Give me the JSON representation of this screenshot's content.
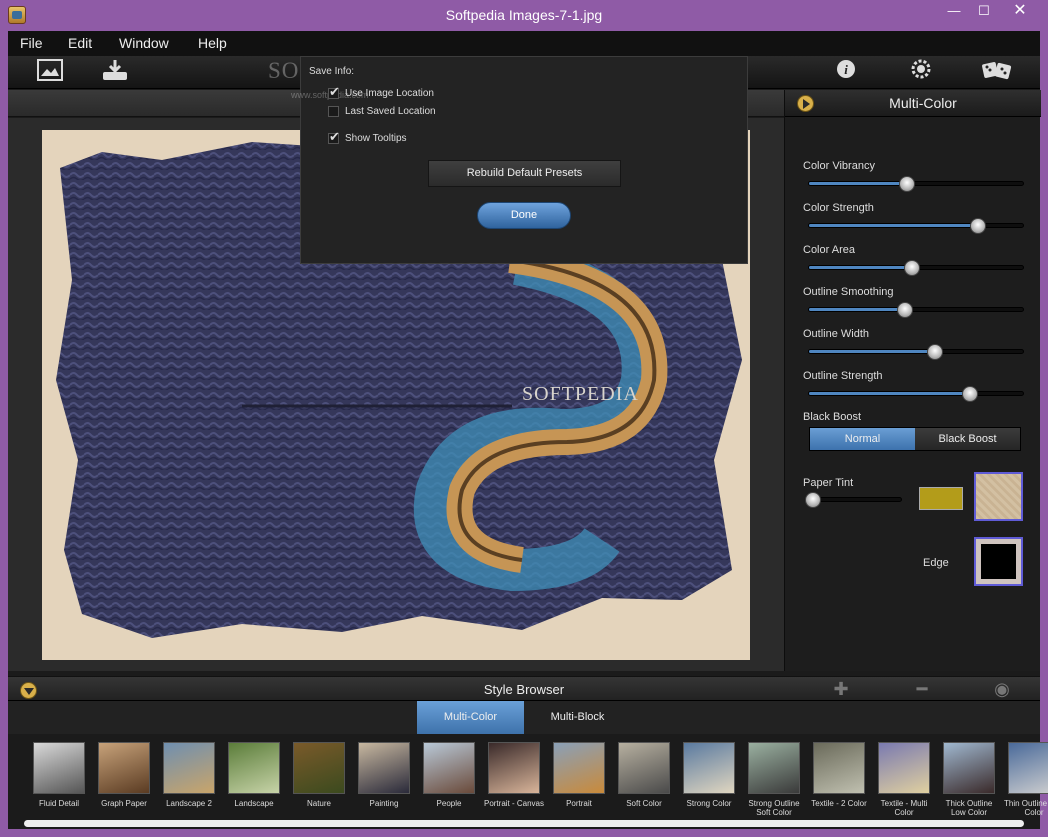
{
  "window": {
    "title": "Softpedia Images-7-1.jpg",
    "minimize": "—",
    "maximize": "☐",
    "close": "✕"
  },
  "menu": [
    "File",
    "Edit",
    "Window",
    "Help"
  ],
  "toolbar": {
    "icons": [
      "open-image-icon",
      "save-icon",
      "info-icon",
      "settings-icon",
      "random-dice-icon"
    ]
  },
  "settings_popup": {
    "section_label": "Save Info:",
    "options": [
      {
        "label": "Use Image Location",
        "checked": true
      },
      {
        "label": "Last Saved Location",
        "checked": false
      },
      {
        "label": "Show Tooltips",
        "checked": true
      }
    ],
    "rebuild_label": "Rebuild Default Presets",
    "done_label": "Done"
  },
  "watermark": {
    "logo": "SOFTPEDIA",
    "url": "www.softpedia.com"
  },
  "panel": {
    "title": "Multi-Color",
    "sliders": [
      {
        "label": "Color Vibrancy",
        "value": 0.46
      },
      {
        "label": "Color Strength",
        "value": 0.79
      },
      {
        "label": "Color Area",
        "value": 0.48
      },
      {
        "label": "Outline Smoothing",
        "value": 0.45
      },
      {
        "label": "Outline Width",
        "value": 0.59
      },
      {
        "label": "Outline Strength",
        "value": 0.75
      }
    ],
    "black_boost": {
      "label": "Black Boost",
      "options": [
        "Normal",
        "Black Boost"
      ],
      "selected": "Normal"
    },
    "paper_tint": {
      "label": "Paper Tint",
      "value": 0.04,
      "color": "#b39c1a"
    },
    "edge_label": "Edge"
  },
  "style_browser": {
    "title": "Style Browser",
    "tabs": [
      "Multi-Color",
      "Multi-Block"
    ],
    "active_tab": "Multi-Color",
    "presets": [
      "Fluid Detail",
      "Graph Paper",
      "Landscape 2",
      "Landscape",
      "Nature",
      "Painting",
      "People",
      "Portrait - Canvas",
      "Portrait",
      "Soft Color",
      "Strong Color",
      "Strong Outline Soft Color",
      "Textile - 2 Color",
      "Textile - Multi Color",
      "Thick Outline Low Color",
      "Thin Outline Low Color"
    ]
  }
}
